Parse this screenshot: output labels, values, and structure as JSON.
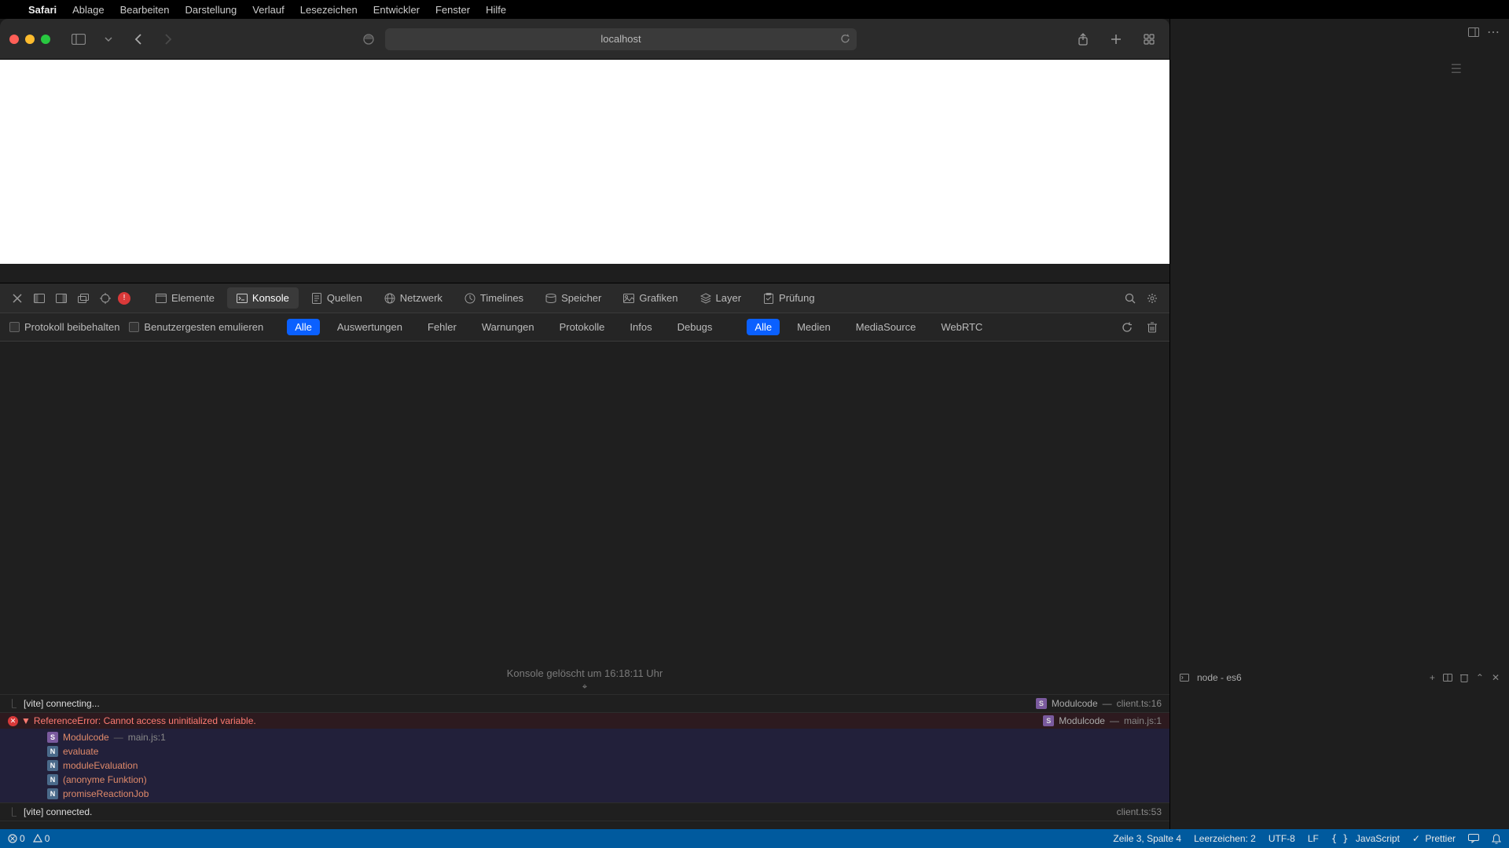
{
  "menubar": {
    "app": "Safari",
    "items": [
      "Ablage",
      "Bearbeiten",
      "Darstellung",
      "Verlauf",
      "Lesezeichen",
      "Entwickler",
      "Fenster",
      "Hilfe"
    ]
  },
  "safari": {
    "address": "localhost"
  },
  "devtools": {
    "error_count": "!",
    "tabs": [
      "Elemente",
      "Konsole",
      "Quellen",
      "Netzwerk",
      "Timelines",
      "Speicher",
      "Grafiken",
      "Layer",
      "Prüfung"
    ],
    "active_tab": "Konsole",
    "filter": {
      "preserve": "Protokoll beibehalten",
      "emulate": "Benutzergesten emulieren",
      "levels1": [
        "Alle",
        "Auswertungen",
        "Fehler",
        "Warnungen",
        "Protokolle",
        "Infos",
        "Debugs"
      ],
      "levels2": [
        "Alle",
        "Medien",
        "MediaSource",
        "WebRTC"
      ]
    },
    "console": {
      "cleared": "Konsole gelöscht um 16:18:11 Uhr",
      "rows": [
        {
          "type": "log",
          "msg": "[vite] connecting...",
          "src_label": "Modulcode",
          "src_file": "client.ts:16"
        },
        {
          "type": "error",
          "msg": "ReferenceError: Cannot access uninitialized variable.",
          "src_label": "Modulcode",
          "src_file": "main.js:1"
        }
      ],
      "stack": [
        {
          "badge": "S",
          "fn": "Modulcode",
          "loc": "main.js:1"
        },
        {
          "badge": "N",
          "fn": "evaluate",
          "loc": ""
        },
        {
          "badge": "N",
          "fn": "moduleEvaluation",
          "loc": ""
        },
        {
          "badge": "N",
          "fn": "(anonyme Funktion)",
          "loc": ""
        },
        {
          "badge": "N",
          "fn": "promiseReactionJob",
          "loc": ""
        }
      ],
      "row3": {
        "msg": "[vite] connected.",
        "src_file": "client.ts:53"
      }
    }
  },
  "side": {
    "terminal_label": "node - es6"
  },
  "statusbar": {
    "err": "0",
    "warn": "0",
    "line": "Zeile 3, Spalte 4",
    "spaces": "Leerzeichen: 2",
    "encoding": "UTF-8",
    "eol": "LF",
    "lang": "JavaScript",
    "prettier": "Prettier"
  }
}
